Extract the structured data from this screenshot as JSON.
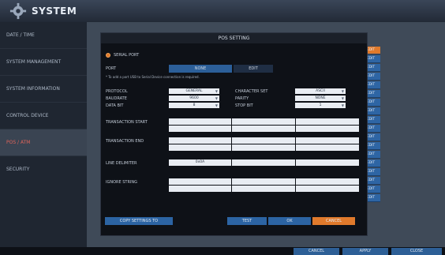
{
  "header": {
    "title": "SYSTEM"
  },
  "sidebar": {
    "items": [
      {
        "label": "DATE / TIME"
      },
      {
        "label": "SYSTEM MANAGEMENT"
      },
      {
        "label": "SYSTEM INFORMATION"
      },
      {
        "label": "CONTROL DEVICE"
      },
      {
        "label": "POS / ATM"
      },
      {
        "label": "SECURITY"
      }
    ]
  },
  "dialog": {
    "title": "POS SETTING",
    "serial_port_label": "SERIAL PORT",
    "port_label": "PORT",
    "port_value": "NONE",
    "port_edit": "EDIT",
    "usb_note": "* To add a port USB to Serial Device connection is required.",
    "protocol_label": "PROTOCOL",
    "protocol_value": "GENERAL",
    "baudrate_label": "BAUDRATE",
    "baudrate_value": "9600",
    "databit_label": "DATA BIT",
    "databit_value": "8",
    "charset_label": "CHARACTER SET",
    "charset_value": "ASCII",
    "parity_label": "PARITY",
    "parity_value": "NONE",
    "stopbit_label": "STOP BIT",
    "stopbit_value": "1",
    "transaction_start_label": "TRANSACTION START",
    "transaction_end_label": "TRANSACTION END",
    "line_delimiter_label": "LINE DELIMITER",
    "line_delimiter_value": "0x0A",
    "ignore_string_label": "IGNORE STRING",
    "copy_settings": "COPY SETTINGS TO",
    "test": "TEST",
    "ok": "OK",
    "cancel": "CANCEL"
  },
  "edit_label": "EDIT",
  "bottom": {
    "cancel": "CANCEL",
    "apply": "APPLY",
    "close": "CLOSE"
  },
  "colors": {
    "accent": "#e07a2c",
    "button_blue": "#2c64a3"
  }
}
